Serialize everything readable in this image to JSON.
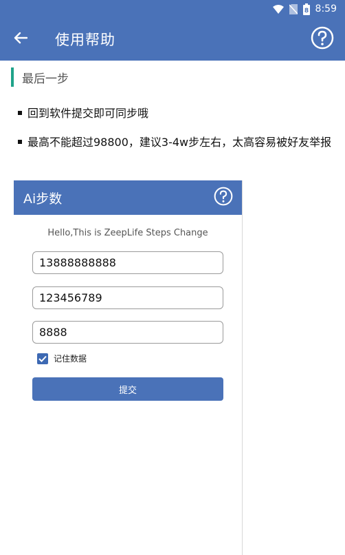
{
  "status_bar": {
    "time": "8:59",
    "battery_level": "8"
  },
  "app_bar": {
    "title": "使用帮助"
  },
  "section": {
    "heading": "最后一步"
  },
  "bullets": [
    "回到软件提交即可同步哦",
    "最高不能超过98800，建议3-4w步左右，太高容易被好友举报"
  ],
  "embedded_app": {
    "title": "Ai步数",
    "subtitle": "Hello,This is ZeepLife Steps Change",
    "account_value": "13888888888",
    "password_value": "123456789",
    "steps_value": "8888",
    "remember_label": "记住数据",
    "remember_checked": true,
    "submit_label": "提交"
  },
  "colors": {
    "primary": "#4a72b8",
    "accent": "#1fa38a"
  }
}
